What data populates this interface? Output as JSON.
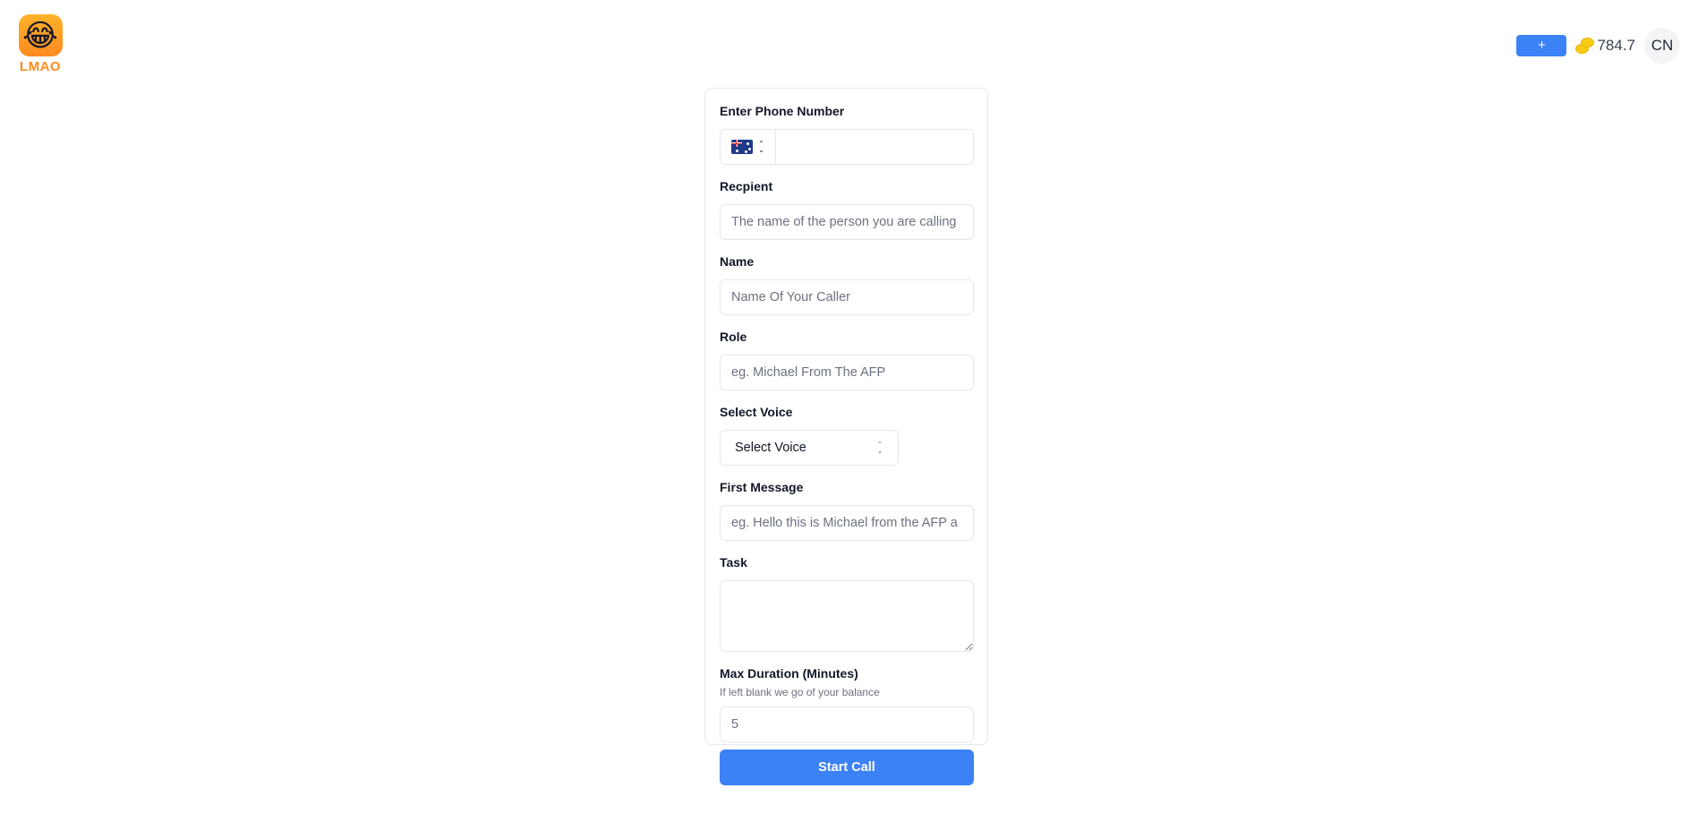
{
  "brand": {
    "name": "LMAO",
    "logo_emoji": "😂"
  },
  "header": {
    "add_label": "+",
    "balance": "784.7",
    "avatar_initials": "CN"
  },
  "form": {
    "phone": {
      "label": "Enter Phone Number",
      "country_flag": "australia-flag",
      "value": ""
    },
    "recipient": {
      "label": "Recpient",
      "placeholder": "The name of the person you are calling"
    },
    "name": {
      "label": "Name",
      "placeholder": "Name Of Your Caller"
    },
    "role": {
      "label": "Role",
      "placeholder": "eg. Michael From The AFP"
    },
    "voice": {
      "label": "Select Voice",
      "selected": "Select Voice"
    },
    "first_message": {
      "label": "First Message",
      "placeholder": "eg. Hello this is Michael from the AFP a"
    },
    "task": {
      "label": "Task",
      "value": ""
    },
    "max_duration": {
      "label": "Max Duration (Minutes)",
      "hint": "If left blank we go of your balance",
      "placeholder": "5"
    },
    "submit_label": "Start Call"
  },
  "colors": {
    "primary": "#3b82f6",
    "brand_orange": "#ff8c1a",
    "coin": "#facc15"
  }
}
